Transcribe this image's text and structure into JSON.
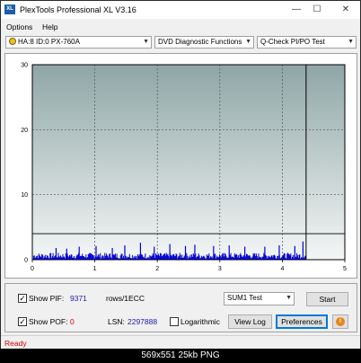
{
  "window": {
    "app_icon_text": "XL",
    "title": "PlexTools Professional XL V3.16",
    "minimize_glyph": "—",
    "maximize_glyph": "☐",
    "close_glyph": "✕"
  },
  "menu": {
    "options": "Options",
    "help": "Help"
  },
  "toolbar": {
    "drive": "HA:8 ID:0  PX-760A",
    "function": "DVD Diagnostic Functions",
    "test": "Q-Check PI/PO Test",
    "dropdown_glyph": "▼"
  },
  "chart_data": {
    "type": "bar",
    "x_ticks": [
      "0",
      "1",
      "2",
      "3",
      "4",
      "5"
    ],
    "y_ticks": [
      "0",
      "10",
      "20",
      "30"
    ],
    "xlim": [
      0,
      5
    ],
    "ylim": [
      0,
      30
    ],
    "grid": true,
    "threshold": 4,
    "end_marker_x": 4.38,
    "scan_end_x": 4.38,
    "bar_color": "#0000dd",
    "background_top": "#8fa6a6",
    "background_bottom": "#f4f6f6",
    "spikes": [
      {
        "x": 0.38,
        "y": 1.8
      },
      {
        "x": 0.55,
        "y": 1.7
      },
      {
        "x": 0.75,
        "y": 2.0
      },
      {
        "x": 1.02,
        "y": 2.1
      },
      {
        "x": 1.28,
        "y": 1.8
      },
      {
        "x": 1.48,
        "y": 2.2
      },
      {
        "x": 1.73,
        "y": 2.6
      },
      {
        "x": 1.95,
        "y": 2.0
      },
      {
        "x": 2.2,
        "y": 2.4
      },
      {
        "x": 2.45,
        "y": 2.1
      },
      {
        "x": 2.6,
        "y": 2.3
      },
      {
        "x": 2.9,
        "y": 2.1
      },
      {
        "x": 3.15,
        "y": 2.2
      },
      {
        "x": 3.4,
        "y": 2.0
      },
      {
        "x": 3.72,
        "y": 2.0
      },
      {
        "x": 3.95,
        "y": 2.2
      },
      {
        "x": 4.2,
        "y": 2.1
      },
      {
        "x": 4.33,
        "y": 2.8
      }
    ]
  },
  "stats": {
    "show_pif_label": "Show PIF:",
    "pif_value": "9371",
    "pif_unit": "rows/1ECC",
    "show_pof_label": "Show POF:",
    "pof_value": "0",
    "lsn_label": "LSN:",
    "lsn_value": "2297888",
    "logarithmic_label": "Logarithmic",
    "pif_checked": true,
    "pof_checked": true,
    "logarithmic_checked": false,
    "check_glyph": "✓"
  },
  "controls": {
    "sum_select": "SUM1 Test",
    "start": "Start",
    "view_log": "View Log",
    "preferences": "Preferences",
    "info_glyph": "i"
  },
  "status": {
    "text": "Ready"
  },
  "caption": {
    "text": "569x551  25kb  PNG"
  }
}
